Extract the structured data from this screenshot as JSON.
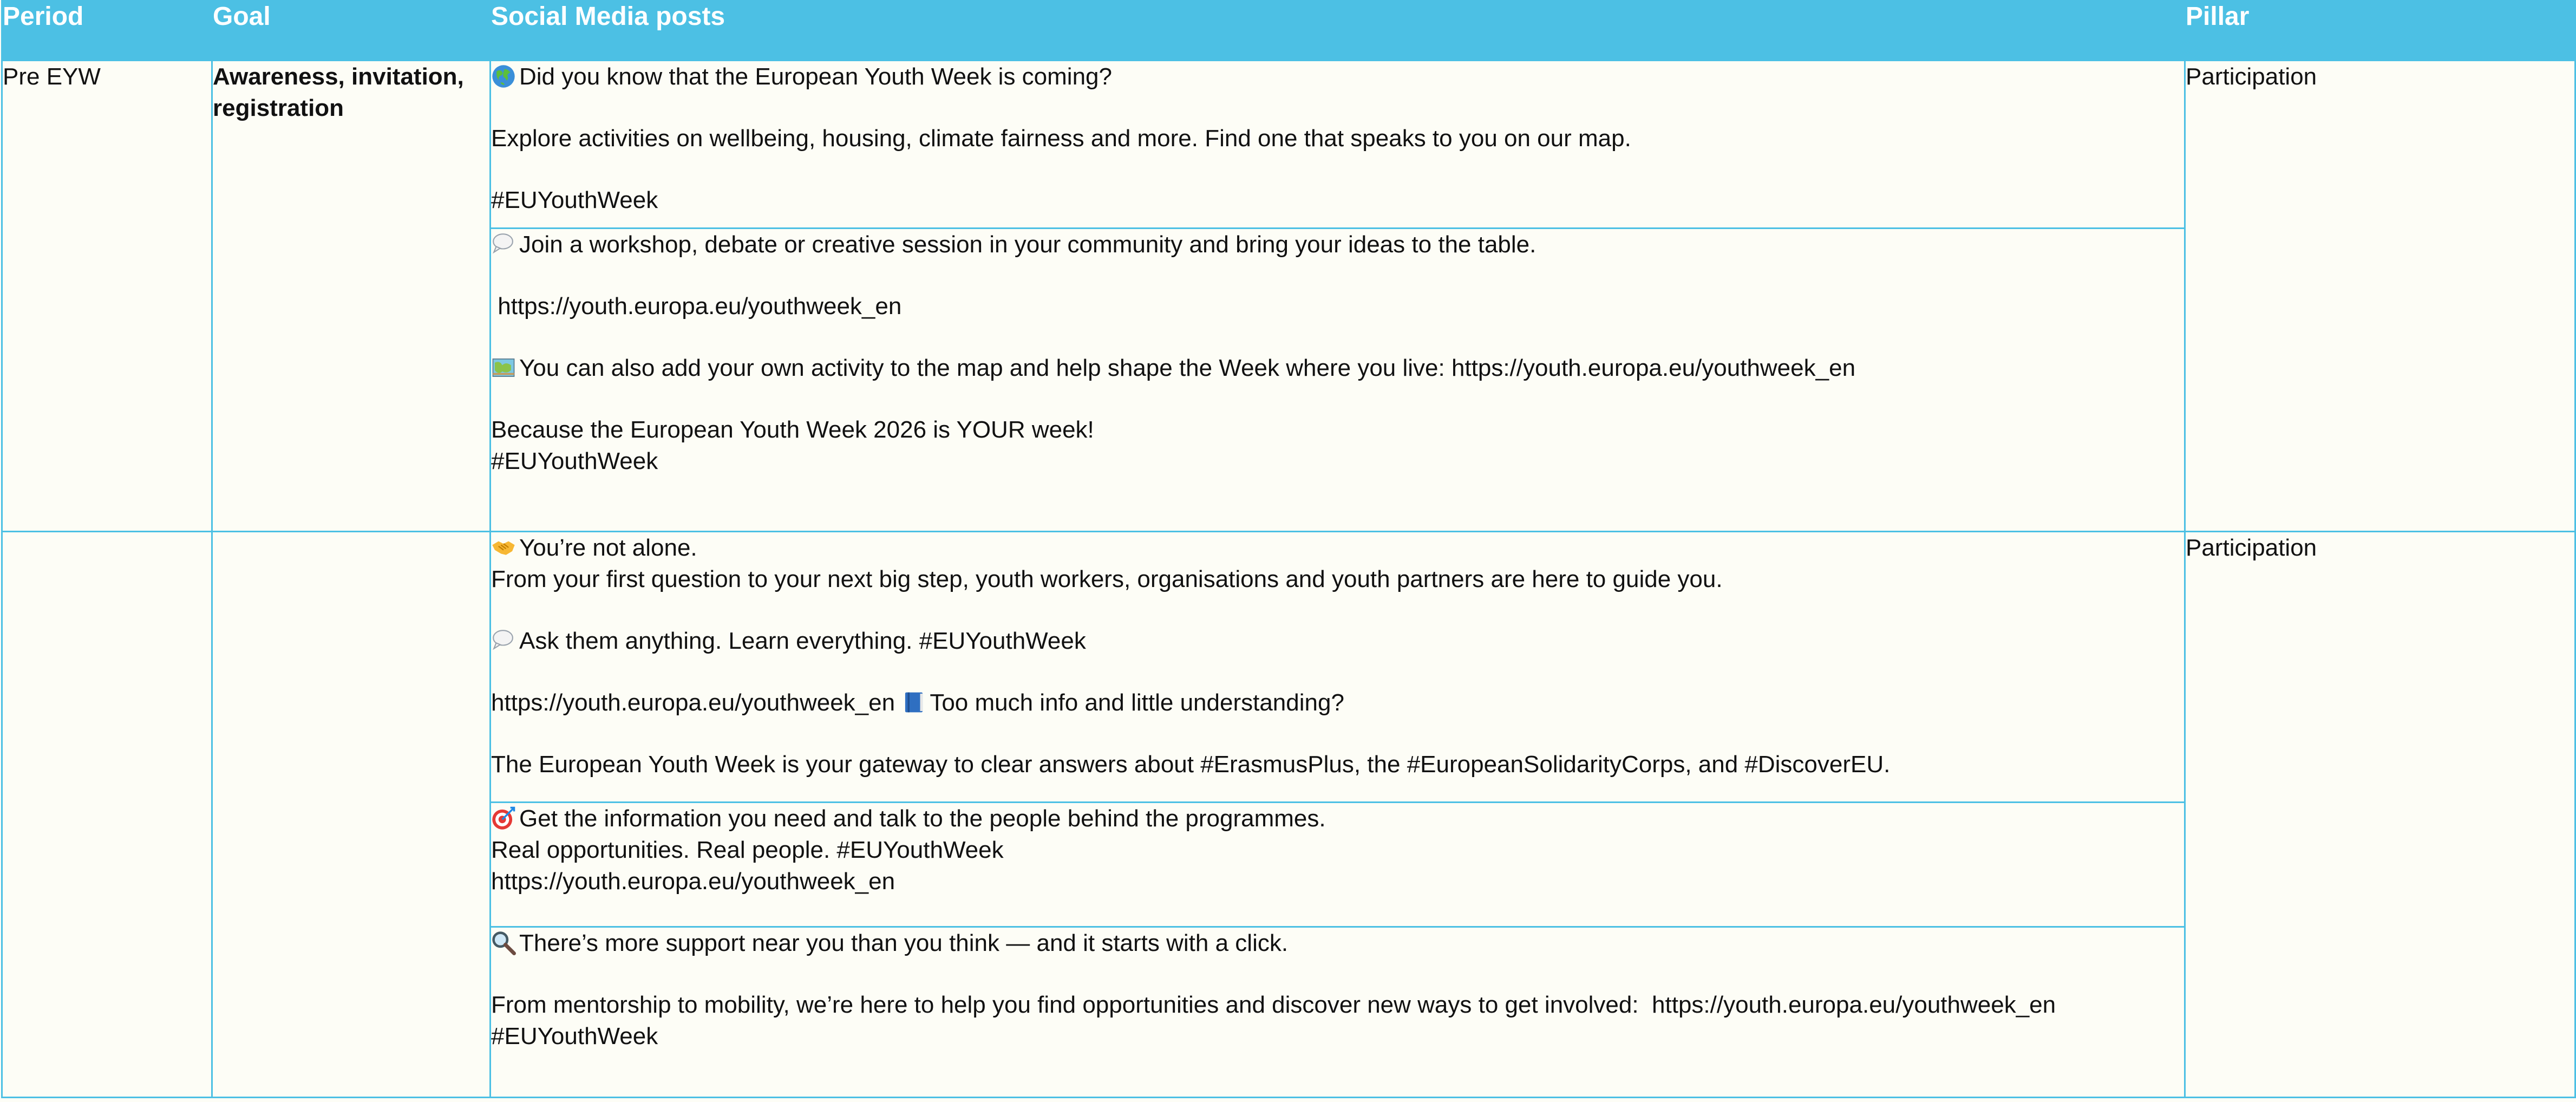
{
  "header": {
    "period": "Period",
    "goal": "Goal",
    "posts": "Social Media posts",
    "pillar": "Pillar"
  },
  "section1": {
    "period": "Pre EYW",
    "goal": "Awareness, invitation, registration",
    "pillar": "Participation",
    "post1": {
      "icon": "globe-icon",
      "line1": "Did you know that the European Youth Week is coming?",
      "line2": "Explore activities on wellbeing, housing, climate fairness and more. Find one that speaks to you on our map.",
      "line3": "#EUYouthWeek"
    },
    "post2": {
      "icon1": "speech-bubble-icon",
      "line1": "Join a workshop, debate or creative session in your community and bring your ideas to the table.",
      "line2": " https://youth.europa.eu/youthweek_en",
      "icon2": "map-icon",
      "line3": "You can also add your own activity to the map and help shape the Week where you live: https://youth.europa.eu/youthweek_en",
      "line4": "Because the European Youth Week 2026 is YOUR week!",
      "line5": "#EUYouthWeek"
    }
  },
  "section2": {
    "period": "",
    "goal": "",
    "pillar": "Participation",
    "post3": {
      "icon1": "handshake-icon",
      "line1": "You’re not alone.",
      "line2": "From your first question to your next big step, youth workers, organisations and youth partners are here to guide you.",
      "icon2": "speech-bubble-icon",
      "line3": "Ask them anything. Learn everything. #EUYouthWeek",
      "line4a": "https://youth.europa.eu/youthweek_en ",
      "icon3": "book-icon",
      "line4b": "Too much info and little understanding?",
      "line5": "The European Youth Week is your gateway to clear answers about #ErasmusPlus, the #EuropeanSolidarityCorps, and #DiscoverEU."
    },
    "post4": {
      "icon": "target-icon",
      "line1": "Get the information you need and talk to the people behind the programmes.",
      "line2": "Real opportunities. Real people. #EUYouthWeek",
      "line3": "https://youth.europa.eu/youthweek_en"
    },
    "post5": {
      "icon": "magnifier-icon",
      "line1": "There’s more support near you than you think — and it starts with a click.",
      "line2": "From mentorship to mobility, we’re here to help you find opportunities and discover new ways to get involved:  https://youth.europa.eu/youthweek_en",
      "line3": "#EUYouthWeek"
    }
  }
}
